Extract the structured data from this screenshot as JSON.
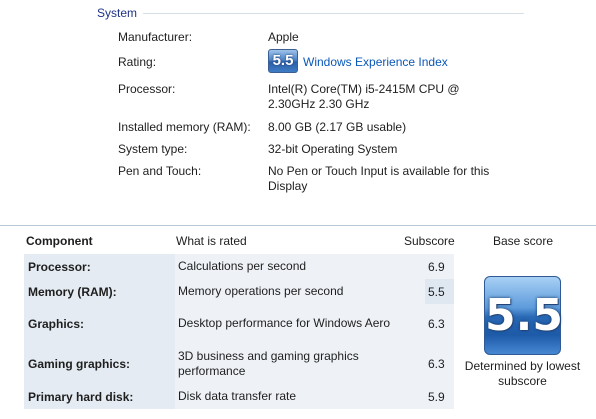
{
  "system": {
    "heading": "System",
    "manufacturer_label": "Manufacturer:",
    "manufacturer_value": "Apple",
    "rating_label": "Rating:",
    "rating_badge": "5.5",
    "rating_link": "Windows Experience Index",
    "processor_label": "Processor:",
    "processor_value": "Intel(R) Core(TM) i5-2415M CPU @ 2.30GHz 2.30 GHz",
    "memory_label": "Installed memory (RAM):",
    "memory_value": "8.00 GB (2.17 GB usable)",
    "type_label": "System type:",
    "type_value": "32-bit Operating System",
    "pen_label": "Pen and Touch:",
    "pen_value": "No Pen or Touch Input is available for this Display"
  },
  "table": {
    "headers": {
      "component": "Component",
      "what": "What is rated",
      "subscore": "Subscore",
      "base": "Base score"
    },
    "rows": [
      {
        "component": "Processor:",
        "what": "Calculations per second",
        "subscore": "6.9"
      },
      {
        "component": "Memory (RAM):",
        "what": "Memory operations per second",
        "subscore": "5.5"
      },
      {
        "component": "Graphics:",
        "what": "Desktop performance for Windows Aero",
        "subscore": "6.3"
      },
      {
        "component": "Gaming graphics:",
        "what": "3D business and gaming graphics performance",
        "subscore": "6.3"
      },
      {
        "component": "Primary hard disk:",
        "what": "Disk data transfer rate",
        "subscore": "5.9"
      }
    ],
    "base_score": "5.5",
    "base_caption": "Determined by lowest subscore"
  }
}
